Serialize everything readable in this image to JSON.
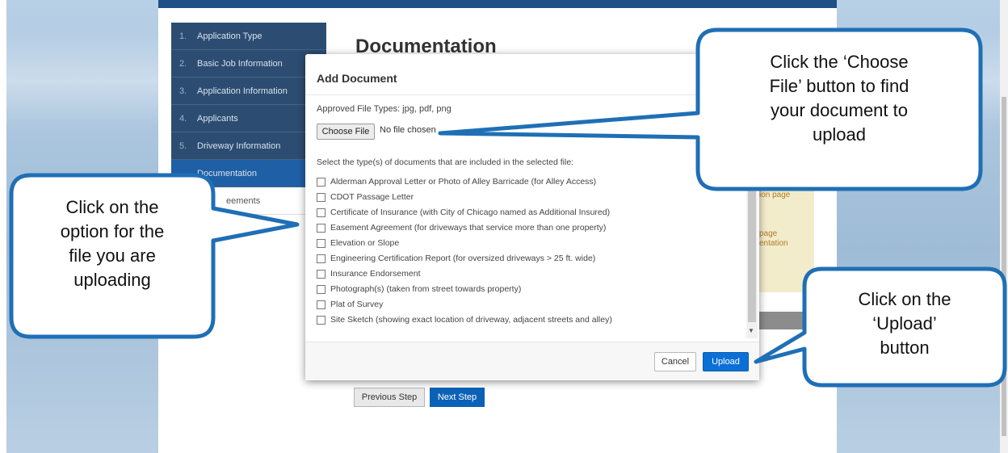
{
  "sidebar": {
    "items": [
      {
        "num": "1.",
        "label": "Application Type"
      },
      {
        "num": "2.",
        "label": "Basic Job Information"
      },
      {
        "num": "3.",
        "label": "Application Information"
      },
      {
        "num": "4.",
        "label": "Applicants"
      },
      {
        "num": "5.",
        "label": "Driveway Information"
      },
      {
        "num": "",
        "label": "Documentation"
      },
      {
        "num": "",
        "label": "eements"
      }
    ]
  },
  "page": {
    "heading": "Documentation",
    "panel_text_1": "ion page",
    "panel_text_2": "page",
    "panel_text_3": "entation",
    "prev_label": "Previous Step",
    "next_label": "Next Step"
  },
  "modal": {
    "title": "Add Document",
    "file_types": "Approved File Types: jpg, pdf, png",
    "choose_label": "Choose File",
    "no_file": "No file chosen",
    "select_label": "Select the type(s) of documents that are included in the selected file:",
    "options": [
      "Alderman Approval Letter or Photo of Alley Barricade (for Alley Access)",
      "CDOT Passage Letter",
      "Certificate of Insurance (with City of Chicago named as Additional Insured)",
      "Easement Agreement (for driveways that service more than one property)",
      "Elevation or Slope",
      "Engineering Certification Report (for oversized driveways > 25 ft. wide)",
      "Insurance Endorsement",
      "Photograph(s) (taken from street towards property)",
      "Plat of Survey",
      "Site Sketch (showing exact location of driveway, adjacent streets and alley)"
    ],
    "cancel_label": "Cancel",
    "upload_label": "Upload"
  },
  "callouts": {
    "choose": [
      "Click the ‘Choose",
      "File’ button to find",
      "your document to",
      "upload"
    ],
    "option": [
      "Click on the",
      "option for the",
      "file you are",
      "uploading"
    ],
    "upload": [
      "Click on the",
      "‘Upload’",
      "button"
    ]
  },
  "colors": {
    "callout_border": "#1f6fb5",
    "primary_button": "#0b6fd6",
    "sidebar_bg": "#2c4d71",
    "sidebar_active": "#1f5fa6"
  }
}
